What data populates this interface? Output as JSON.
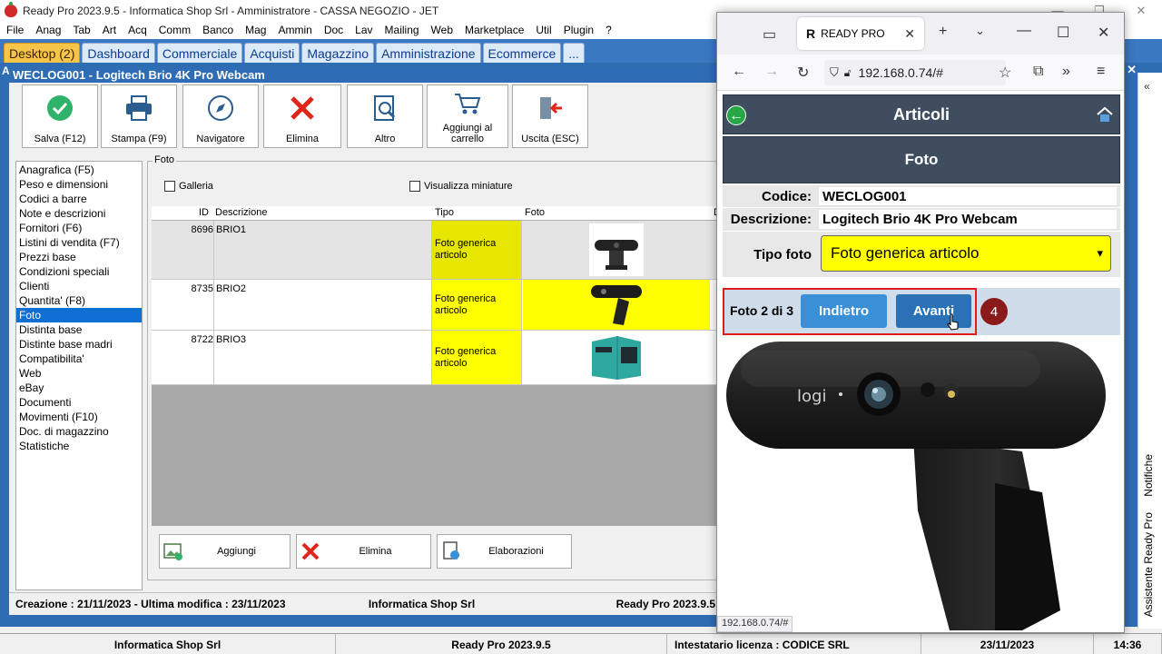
{
  "app": {
    "title": "Ready Pro 2023.9.5 - Informatica Shop Srl - Amministratore - CASSA NEGOZIO - JET",
    "menu": [
      "File",
      "Anag",
      "Tab",
      "Art",
      "Acq",
      "Comm",
      "Banco",
      "Mag",
      "Ammin",
      "Doc",
      "Lav",
      "Mailing",
      "Web",
      "Marketplace",
      "Util",
      "Plugin",
      "?"
    ],
    "tabs": [
      "Desktop (2)",
      "Dashboard",
      "Commerciale",
      "Acquisti",
      "Magazzino",
      "Amministrazione",
      "Ecommerce",
      "..."
    ]
  },
  "article_window": {
    "title": "WECLOG001 - Logitech Brio 4K Pro Webcam",
    "toolbar": {
      "save": "Salva (F12)",
      "print": "Stampa (F9)",
      "navigator": "Navigatore",
      "delete": "Elimina",
      "other": "Altro",
      "add_cart": "Aggiungi al carrello",
      "exit": "Uscita (ESC)"
    },
    "sections": [
      "Anagrafica (F5)",
      "Peso e dimensioni",
      "Codici a barre",
      "Note e descrizioni",
      "Fornitori (F6)",
      "Listini di vendita (F7)",
      "Prezzi base",
      "Condizioni speciali",
      "Clienti",
      "Quantita' (F8)",
      "Foto",
      "Distinta base",
      "Distinte base madri",
      "Compatibilita'",
      "Web",
      "eBay",
      "Documenti",
      "Movimenti (F10)",
      "Doc. di magazzino",
      "Statistiche"
    ],
    "selected_section": "Foto",
    "foto_group_label": "Foto",
    "checkbox_gallery": "Galleria",
    "checkbox_thumbs": "Visualizza miniature",
    "grid_headers": {
      "id": "ID",
      "desc": "Descrizione",
      "tipo": "Tipo",
      "foto": "Foto"
    },
    "rows": [
      {
        "id": "8696",
        "desc": "BRIO1",
        "tipo": "Foto generica articolo"
      },
      {
        "id": "8735",
        "desc": "BRIO2",
        "tipo": "Foto generica articolo"
      },
      {
        "id": "8722",
        "desc": "BRIO3",
        "tipo": "Foto generica articolo"
      }
    ],
    "bottom_buttons": {
      "add": "Aggiungi",
      "delete": "Elimina",
      "process": "Elaborazioni"
    },
    "status": {
      "dates": "Creazione : 21/11/2023 - Ultima modifica : 23/11/2023",
      "company": "Informatica Shop Srl",
      "version": "Ready Pro 2023.9.5"
    }
  },
  "app_status": {
    "company": "Informatica Shop Srl",
    "version": "Ready Pro 2023.9.5",
    "license": "Intestatario licenza : CODICE SRL",
    "date": "23/11/2023",
    "time": "14:36"
  },
  "side_panel": {
    "notifications": "Notifiche",
    "assistant": "Assistente Ready Pro"
  },
  "browser": {
    "tab_title": "READY PRO",
    "url": "192.168.0.74/#",
    "status_url": "192.168.0.74/#",
    "page": {
      "header": "Articoli",
      "subheader": "Foto",
      "codice_label": "Codice:",
      "codice_value": "WECLOG001",
      "descrizione_label": "Descrizione:",
      "descrizione_value": "Logitech Brio 4K Pro Webcam",
      "tipo_label": "Tipo foto",
      "tipo_value": "Foto generica articolo",
      "counter": "Foto 2 di 3",
      "back_button": "Indietro",
      "next_button": "Avanti",
      "step_badge": "4",
      "logo_text": "logi"
    }
  },
  "colors": {
    "accent_blue": "#2e6cb5",
    "highlight_yellow": "#ffff00",
    "callout_red": "#e01b1b",
    "step_badge": "#8b1a1a"
  }
}
